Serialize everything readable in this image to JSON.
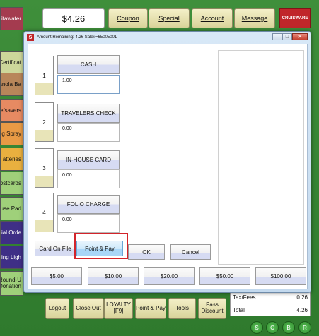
{
  "pos": {
    "amount": "$4.26",
    "top_buttons": [
      "Coupon",
      "Special",
      "Account",
      "Message"
    ],
    "logo_text": "CRUISWARE",
    "left_categories": [
      "itawater",
      "Certificat",
      "anola Ba",
      "efsavers",
      "ug Spray",
      "atteries",
      "ostcards",
      "ouse Pad",
      "ecial Orde",
      "nding Ligh",
      "Round-U Donation"
    ],
    "bottom_buttons": [
      "Logout",
      "Close Out",
      "LOYALTY [F9]",
      "Point & Pay",
      "Tools",
      "Pass Discount"
    ],
    "totals": {
      "tax_label": "Tax/Fees",
      "tax_value": "0.26",
      "total_label": "Total",
      "total_value": "4.26"
    },
    "circle_buttons": [
      "S",
      "C",
      "B",
      "R"
    ]
  },
  "dialog": {
    "icon": "S",
    "title": "Amount Remaining:  4.26  Sale#=65005001",
    "tenders": [
      {
        "number": "1",
        "label": "CASH",
        "value": "1.00"
      },
      {
        "number": "2",
        "label": "TRAVELERS CHECK",
        "value": "0.00"
      },
      {
        "number": "3",
        "label": "IN-HOUSE CARD",
        "value": "0.00"
      },
      {
        "number": "4",
        "label": "FOLIO CHARGE",
        "value": "0.00"
      }
    ],
    "actions": {
      "card_on_file": "Card On File",
      "point_pay": "Point & Pay",
      "ok": "OK",
      "cancel": "Cancel"
    },
    "cash_buttons": [
      "$5.00",
      "$10.00",
      "$20.00",
      "$50.00",
      "$100.00"
    ],
    "window_buttons": {
      "minimize": "–",
      "maximize": "□",
      "close": "✕"
    }
  }
}
